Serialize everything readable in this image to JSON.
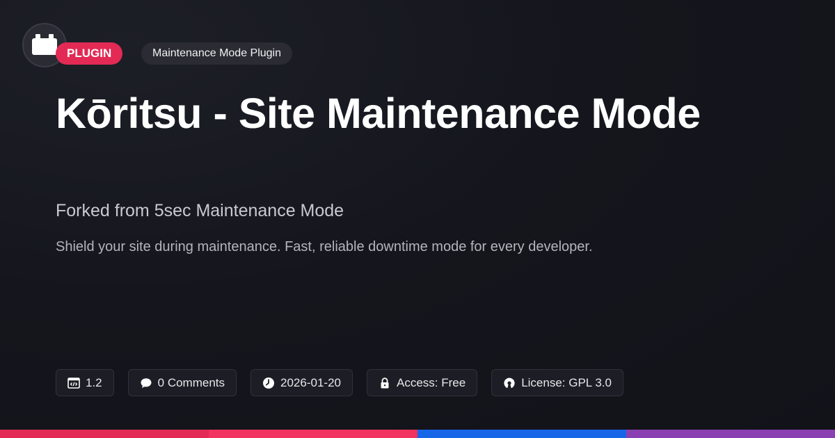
{
  "badges": {
    "type": "PLUGIN",
    "category": "Maintenance Mode Plugin"
  },
  "title": "Kōritsu - Site Maintenance Mode",
  "subtitle": "Forked from 5sec Maintenance Mode",
  "description": "Shield your site during maintenance. Fast, reliable downtime mode for every developer.",
  "meta": [
    {
      "icon": "code-window-icon",
      "label": "1.2"
    },
    {
      "icon": "comment-icon",
      "label": "0 Comments"
    },
    {
      "icon": "clock-icon",
      "label": "2026-01-20"
    },
    {
      "icon": "lock-icon",
      "label": "Access: Free"
    },
    {
      "icon": "open-source-icon",
      "label": "License: GPL 3.0"
    }
  ],
  "colors": {
    "accent": "#e22a55",
    "stripes": [
      "#e22a55",
      "#f2325f",
      "#1866e8",
      "#8a3fb3"
    ]
  }
}
